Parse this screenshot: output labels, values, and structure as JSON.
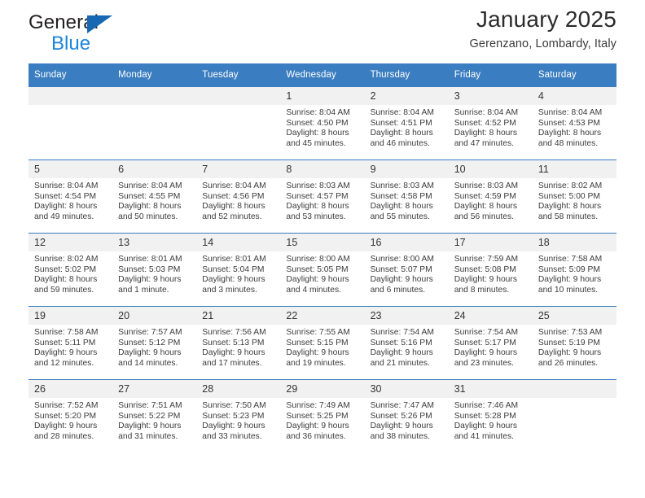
{
  "brand": {
    "name_part1": "General",
    "name_part2": "Blue",
    "accent_color": "#1668b3",
    "blue_text_color": "#1c86d9",
    "logo_icon": "triangle-flag-icon"
  },
  "header": {
    "title": "January 2025",
    "location": "Gerenzano, Lombardy, Italy"
  },
  "calendar": {
    "header_bg": "#3a7dc0",
    "header_text_color": "#ffffff",
    "daynum_bg": "#f1f1f1",
    "weekday_headers": [
      "Sunday",
      "Monday",
      "Tuesday",
      "Wednesday",
      "Thursday",
      "Friday",
      "Saturday"
    ],
    "weeks": [
      [
        {
          "day": "",
          "empty": true,
          "lines": []
        },
        {
          "day": "",
          "empty": true,
          "lines": []
        },
        {
          "day": "",
          "empty": true,
          "lines": []
        },
        {
          "day": "1",
          "empty": false,
          "lines": [
            "Sunrise: 8:04 AM",
            "Sunset: 4:50 PM",
            "Daylight: 8 hours",
            "and 45 minutes."
          ]
        },
        {
          "day": "2",
          "empty": false,
          "lines": [
            "Sunrise: 8:04 AM",
            "Sunset: 4:51 PM",
            "Daylight: 8 hours",
            "and 46 minutes."
          ]
        },
        {
          "day": "3",
          "empty": false,
          "lines": [
            "Sunrise: 8:04 AM",
            "Sunset: 4:52 PM",
            "Daylight: 8 hours",
            "and 47 minutes."
          ]
        },
        {
          "day": "4",
          "empty": false,
          "lines": [
            "Sunrise: 8:04 AM",
            "Sunset: 4:53 PM",
            "Daylight: 8 hours",
            "and 48 minutes."
          ]
        }
      ],
      [
        {
          "day": "5",
          "empty": false,
          "lines": [
            "Sunrise: 8:04 AM",
            "Sunset: 4:54 PM",
            "Daylight: 8 hours",
            "and 49 minutes."
          ]
        },
        {
          "day": "6",
          "empty": false,
          "lines": [
            "Sunrise: 8:04 AM",
            "Sunset: 4:55 PM",
            "Daylight: 8 hours",
            "and 50 minutes."
          ]
        },
        {
          "day": "7",
          "empty": false,
          "lines": [
            "Sunrise: 8:04 AM",
            "Sunset: 4:56 PM",
            "Daylight: 8 hours",
            "and 52 minutes."
          ]
        },
        {
          "day": "8",
          "empty": false,
          "lines": [
            "Sunrise: 8:03 AM",
            "Sunset: 4:57 PM",
            "Daylight: 8 hours",
            "and 53 minutes."
          ]
        },
        {
          "day": "9",
          "empty": false,
          "lines": [
            "Sunrise: 8:03 AM",
            "Sunset: 4:58 PM",
            "Daylight: 8 hours",
            "and 55 minutes."
          ]
        },
        {
          "day": "10",
          "empty": false,
          "lines": [
            "Sunrise: 8:03 AM",
            "Sunset: 4:59 PM",
            "Daylight: 8 hours",
            "and 56 minutes."
          ]
        },
        {
          "day": "11",
          "empty": false,
          "lines": [
            "Sunrise: 8:02 AM",
            "Sunset: 5:00 PM",
            "Daylight: 8 hours",
            "and 58 minutes."
          ]
        }
      ],
      [
        {
          "day": "12",
          "empty": false,
          "lines": [
            "Sunrise: 8:02 AM",
            "Sunset: 5:02 PM",
            "Daylight: 8 hours",
            "and 59 minutes."
          ]
        },
        {
          "day": "13",
          "empty": false,
          "lines": [
            "Sunrise: 8:01 AM",
            "Sunset: 5:03 PM",
            "Daylight: 9 hours",
            "and 1 minute."
          ]
        },
        {
          "day": "14",
          "empty": false,
          "lines": [
            "Sunrise: 8:01 AM",
            "Sunset: 5:04 PM",
            "Daylight: 9 hours",
            "and 3 minutes."
          ]
        },
        {
          "day": "15",
          "empty": false,
          "lines": [
            "Sunrise: 8:00 AM",
            "Sunset: 5:05 PM",
            "Daylight: 9 hours",
            "and 4 minutes."
          ]
        },
        {
          "day": "16",
          "empty": false,
          "lines": [
            "Sunrise: 8:00 AM",
            "Sunset: 5:07 PM",
            "Daylight: 9 hours",
            "and 6 minutes."
          ]
        },
        {
          "day": "17",
          "empty": false,
          "lines": [
            "Sunrise: 7:59 AM",
            "Sunset: 5:08 PM",
            "Daylight: 9 hours",
            "and 8 minutes."
          ]
        },
        {
          "day": "18",
          "empty": false,
          "lines": [
            "Sunrise: 7:58 AM",
            "Sunset: 5:09 PM",
            "Daylight: 9 hours",
            "and 10 minutes."
          ]
        }
      ],
      [
        {
          "day": "19",
          "empty": false,
          "lines": [
            "Sunrise: 7:58 AM",
            "Sunset: 5:11 PM",
            "Daylight: 9 hours",
            "and 12 minutes."
          ]
        },
        {
          "day": "20",
          "empty": false,
          "lines": [
            "Sunrise: 7:57 AM",
            "Sunset: 5:12 PM",
            "Daylight: 9 hours",
            "and 14 minutes."
          ]
        },
        {
          "day": "21",
          "empty": false,
          "lines": [
            "Sunrise: 7:56 AM",
            "Sunset: 5:13 PM",
            "Daylight: 9 hours",
            "and 17 minutes."
          ]
        },
        {
          "day": "22",
          "empty": false,
          "lines": [
            "Sunrise: 7:55 AM",
            "Sunset: 5:15 PM",
            "Daylight: 9 hours",
            "and 19 minutes."
          ]
        },
        {
          "day": "23",
          "empty": false,
          "lines": [
            "Sunrise: 7:54 AM",
            "Sunset: 5:16 PM",
            "Daylight: 9 hours",
            "and 21 minutes."
          ]
        },
        {
          "day": "24",
          "empty": false,
          "lines": [
            "Sunrise: 7:54 AM",
            "Sunset: 5:17 PM",
            "Daylight: 9 hours",
            "and 23 minutes."
          ]
        },
        {
          "day": "25",
          "empty": false,
          "lines": [
            "Sunrise: 7:53 AM",
            "Sunset: 5:19 PM",
            "Daylight: 9 hours",
            "and 26 minutes."
          ]
        }
      ],
      [
        {
          "day": "26",
          "empty": false,
          "lines": [
            "Sunrise: 7:52 AM",
            "Sunset: 5:20 PM",
            "Daylight: 9 hours",
            "and 28 minutes."
          ]
        },
        {
          "day": "27",
          "empty": false,
          "lines": [
            "Sunrise: 7:51 AM",
            "Sunset: 5:22 PM",
            "Daylight: 9 hours",
            "and 31 minutes."
          ]
        },
        {
          "day": "28",
          "empty": false,
          "lines": [
            "Sunrise: 7:50 AM",
            "Sunset: 5:23 PM",
            "Daylight: 9 hours",
            "and 33 minutes."
          ]
        },
        {
          "day": "29",
          "empty": false,
          "lines": [
            "Sunrise: 7:49 AM",
            "Sunset: 5:25 PM",
            "Daylight: 9 hours",
            "and 36 minutes."
          ]
        },
        {
          "day": "30",
          "empty": false,
          "lines": [
            "Sunrise: 7:47 AM",
            "Sunset: 5:26 PM",
            "Daylight: 9 hours",
            "and 38 minutes."
          ]
        },
        {
          "day": "31",
          "empty": false,
          "lines": [
            "Sunrise: 7:46 AM",
            "Sunset: 5:28 PM",
            "Daylight: 9 hours",
            "and 41 minutes."
          ]
        },
        {
          "day": "",
          "empty": true,
          "lines": []
        }
      ]
    ]
  }
}
